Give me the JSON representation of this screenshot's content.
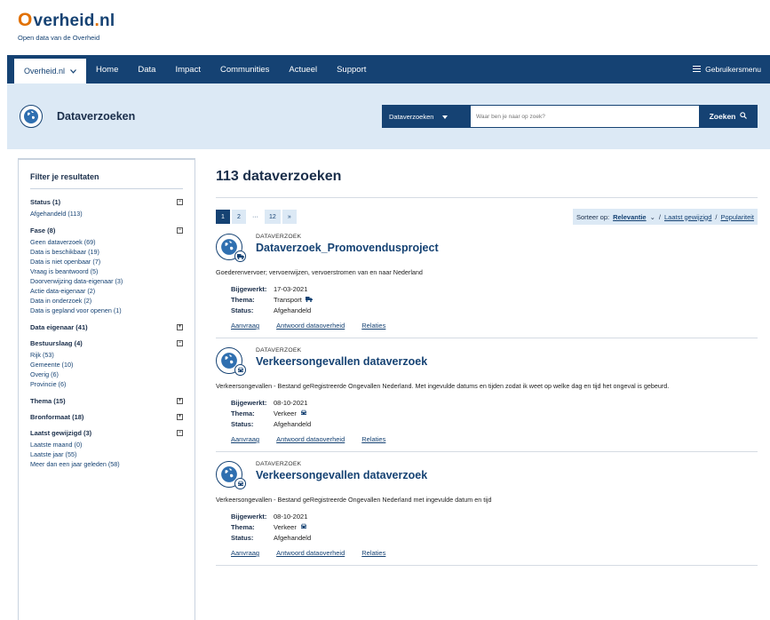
{
  "brand": {
    "logo_mark": "O",
    "logo_main": "verheid",
    "logo_dot": ".",
    "logo_tld": "nl",
    "tagline": "Open data van de Overheid"
  },
  "nav": {
    "site_select": "Overheid.nl",
    "items": [
      "Home",
      "Data",
      "Impact",
      "Communities",
      "Actueel",
      "Support"
    ],
    "user_menu": "Gebruikersmenu"
  },
  "banner": {
    "title": "Dataverzoeken",
    "search_scope": "Dataverzoeken",
    "search_placeholder": "Waar ben je naar op zoek?",
    "search_button": "Zoeken"
  },
  "sidebar": {
    "title": "Filter je resultaten",
    "groups": [
      {
        "label": "Status (1)",
        "toggle": "−",
        "options": [
          "Afgehandeld (113)"
        ]
      },
      {
        "label": "Fase (8)",
        "toggle": "−",
        "options": [
          "Geen dataverzoek (69)",
          "Data is beschikbaar (19)",
          "Data is niet openbaar (7)",
          "Vraag is beantwoord (5)",
          "Doorverwijzing data-eigenaar (3)",
          "Actie data-eigenaar (2)",
          "Data in onderzoek (2)",
          "Data is gepland voor openen (1)"
        ]
      },
      {
        "label": "Data eigenaar (41)",
        "toggle": "+",
        "options": []
      },
      {
        "label": "Bestuurslaag (4)",
        "toggle": "−",
        "options": [
          "Rijk (53)",
          "Gemeente (10)",
          "Overig (6)",
          "Provincie (6)"
        ]
      },
      {
        "label": "Thema (15)",
        "toggle": "+",
        "options": []
      },
      {
        "label": "Bronformaat (18)",
        "toggle": "+",
        "options": []
      },
      {
        "label": "Laatst gewijzigd (3)",
        "toggle": "−",
        "options": [
          "Laatste maand (0)",
          "Laatste jaar (55)",
          "Meer dan een jaar geleden (58)"
        ]
      }
    ]
  },
  "main": {
    "heading": "113 dataverzoeken",
    "pager": {
      "p1": "1",
      "p2": "2",
      "ellipsis": "···",
      "last": "12",
      "next": "»"
    },
    "sort": {
      "label": "Sorteer op:",
      "relevance": "Relevantie",
      "chevron": "⌄",
      "sep": "/",
      "latest": "Laatst gewijzigd",
      "popularity": "Populariteit"
    },
    "results": [
      {
        "type": "DATAVERZOEK",
        "title": "Dataverzoek_Promovendusproject",
        "description": "Goederenvervoer; vervoerwijzen, vervoerstromen van en naar Nederland",
        "updated_label": "Bijgewerkt:",
        "updated": "17-03-2021",
        "theme_label": "Thema:",
        "theme": "Transport",
        "status_label": "Status:",
        "status": "Afgehandeld",
        "links": [
          "Aanvraag",
          "Antwoord dataoverheid",
          "Relaties"
        ]
      },
      {
        "type": "DATAVERZOEK",
        "title": "Verkeersongevallen dataverzoek",
        "description": "Verkeersongevallen - Bestand geRegistreerde Ongevallen Nederland. Met ingevulde datums en tijden zodat ik weet op welke dag en tijd het ongeval is gebeurd.",
        "updated_label": "Bijgewerkt:",
        "updated": "08-10-2021",
        "theme_label": "Thema:",
        "theme": "Verkeer",
        "status_label": "Status:",
        "status": "Afgehandeld",
        "links": [
          "Aanvraag",
          "Antwoord dataoverheid",
          "Relaties"
        ]
      },
      {
        "type": "DATAVERZOEK",
        "title": "Verkeersongevallen dataverzoek",
        "description": "Verkeersongevallen - Bestand geRegistreerde Ongevallen Nederland met ingevulde datum en tijd",
        "updated_label": "Bijgewerkt:",
        "updated": "08-10-2021",
        "theme_label": "Thema:",
        "theme": "Verkeer",
        "status_label": "Status:",
        "status": "Afgehandeld",
        "links": [
          "Aanvraag",
          "Antwoord dataoverheid",
          "Relaties"
        ]
      }
    ]
  },
  "colors": {
    "primary": "#154273",
    "accent": "#e17000",
    "banner_bg": "#dce9f5"
  }
}
